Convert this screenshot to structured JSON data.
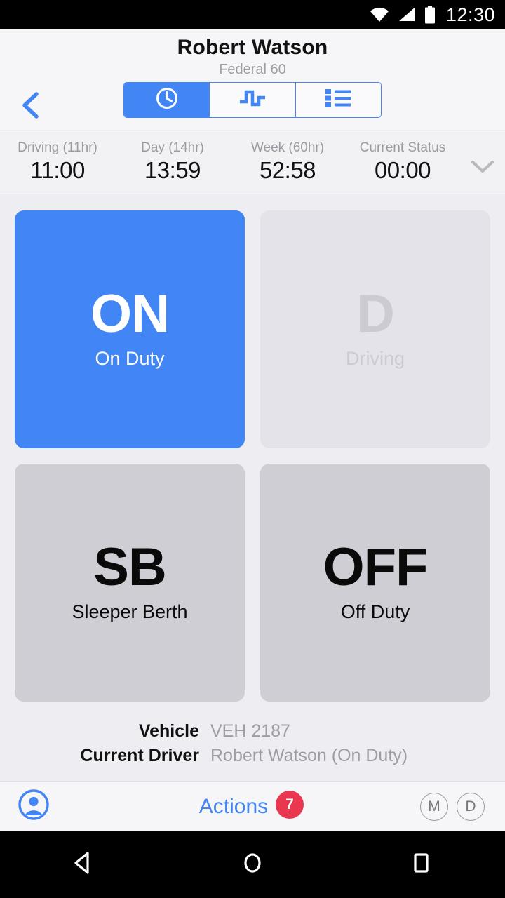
{
  "status_bar": {
    "time": "12:30",
    "icons": [
      "wifi-icon",
      "cell-signal-icon",
      "battery-icon"
    ]
  },
  "header": {
    "back_icon": "chevron-left-icon",
    "title": "Robert Watson",
    "subtitle": "Federal 60",
    "segments": [
      {
        "name": "clock-tab",
        "icon": "clock-icon",
        "active": true
      },
      {
        "name": "graph-tab",
        "icon": "square-wave-icon",
        "active": false
      },
      {
        "name": "list-tab",
        "icon": "list-icon",
        "active": false
      }
    ]
  },
  "stats": {
    "expand_icon": "chevron-down-icon",
    "items": [
      {
        "label": "Driving (11hr)",
        "value": "11:00"
      },
      {
        "label": "Day (14hr)",
        "value": "13:59"
      },
      {
        "label": "Week (60hr)",
        "value": "52:58"
      },
      {
        "label": "Current Status",
        "value": "00:00"
      }
    ]
  },
  "duty_cards": [
    {
      "abbr": "ON",
      "name": "On Duty",
      "state": "selected"
    },
    {
      "abbr": "D",
      "name": "Driving",
      "state": "disabled"
    },
    {
      "abbr": "SB",
      "name": "Sleeper Berth",
      "state": "idle"
    },
    {
      "abbr": "OFF",
      "name": "Off Duty",
      "state": "idle"
    }
  ],
  "vehicle_info": [
    {
      "label": "Vehicle",
      "value": "VEH 2187"
    },
    {
      "label": "Current Driver",
      "value": "Robert Watson (On Duty)"
    }
  ],
  "bottom_bar": {
    "profile_icon": "account-circle-icon",
    "actions_label": "Actions",
    "actions_badge": "7",
    "tokens": [
      "M",
      "D"
    ]
  },
  "nav_bar": {
    "back": "nav-back-icon",
    "home": "nav-home-icon",
    "recents": "nav-recents-icon"
  },
  "colors": {
    "accent": "#4285f4",
    "badge": "#e8374f",
    "page_bg": "#eeeef2",
    "card_idle": "#ceced4",
    "card_disabled": "#e4e3e9",
    "muted_text": "#9d9da4"
  }
}
